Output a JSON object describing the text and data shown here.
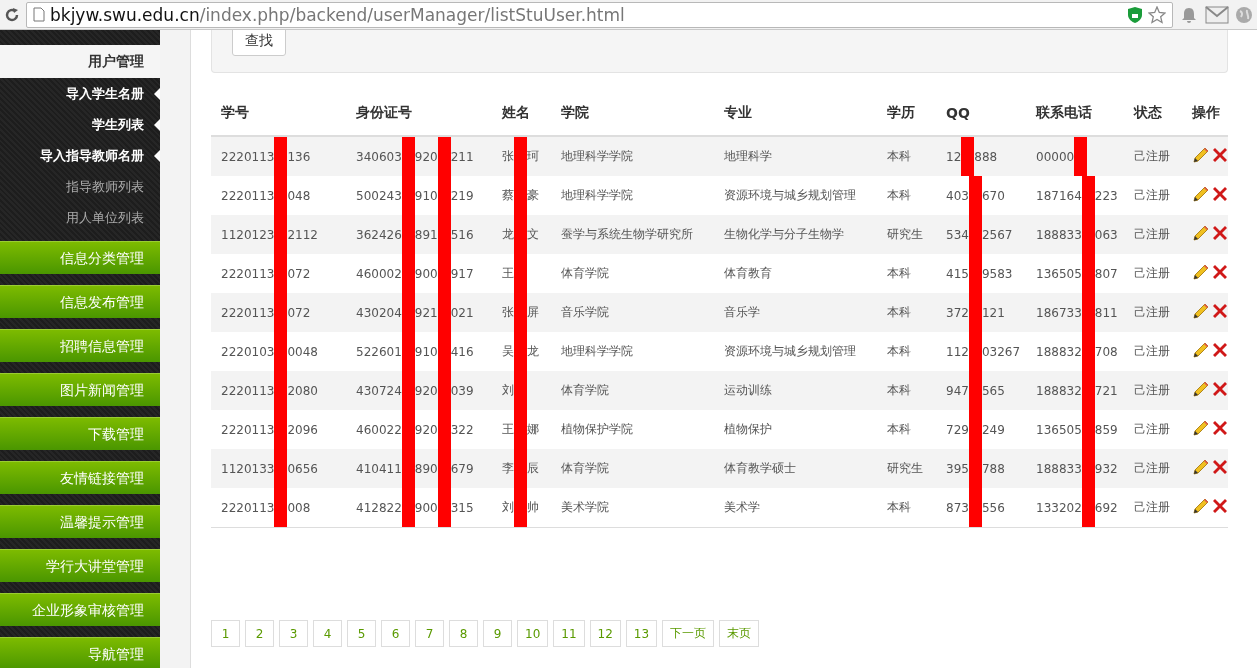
{
  "address_bar": {
    "domain": "bkjyw.swu.edu.cn",
    "path": "/index.php/backend/userManager/listStuUser.html"
  },
  "sidebar": {
    "section": "用户管理",
    "subitems": [
      {
        "label": "导入学生名册",
        "highlighted": true
      },
      {
        "label": "学生列表",
        "highlighted": true
      },
      {
        "label": "导入指导教师名册",
        "highlighted": true
      },
      {
        "label": "指导教师列表",
        "highlighted": false
      },
      {
        "label": "用人单位列表",
        "highlighted": false
      }
    ],
    "items": [
      "信息分类管理",
      "信息发布管理",
      "招聘信息管理",
      "图片新闻管理",
      "下载管理",
      "友情链接管理",
      "温馨提示管理",
      "学行大讲堂管理",
      "企业形象审核管理",
      "导航管理"
    ]
  },
  "search_button": "查找",
  "table": {
    "columns": [
      {
        "label": "学号",
        "kind": "text"
      },
      {
        "label": "身份证号",
        "kind": "text"
      },
      {
        "label": "姓名",
        "kind": "text"
      },
      {
        "label": "学院",
        "kind": "text"
      },
      {
        "label": "专业",
        "kind": "text"
      },
      {
        "label": "学历",
        "kind": "text"
      },
      {
        "label": "QQ",
        "kind": "text"
      },
      {
        "label": "联系电话",
        "kind": "text"
      },
      {
        "label": "状态",
        "kind": "text"
      },
      {
        "label": "操作",
        "kind": "actions"
      }
    ],
    "rows": [
      {
        "cells": [
          [
            "2220113",
            "136"
          ],
          [
            "340603",
            "920",
            "211"
          ],
          [
            "张",
            "珂"
          ],
          "地理科学学院",
          "地理科学",
          "本科",
          [
            "12",
            "888"
          ],
          [
            "00000"
          ],
          "己注册"
        ]
      },
      {
        "cells": [
          [
            "2220113",
            "048"
          ],
          [
            "500243",
            "910",
            "219"
          ],
          [
            "蔡",
            "豪"
          ],
          "地理科学学院",
          "资源环境与城乡规划管理",
          "本科",
          [
            "403",
            "670"
          ],
          [
            "187164",
            "223"
          ],
          "己注册"
        ]
      },
      {
        "cells": [
          [
            "1120123",
            "2112"
          ],
          [
            "362426",
            "891",
            "516"
          ],
          [
            "龙",
            "文"
          ],
          "蚕学与系统生物学研究所",
          "生物化学与分子生物学",
          "研究生",
          [
            "534",
            "2567"
          ],
          [
            "188833",
            "063"
          ],
          "己注册"
        ]
      },
      {
        "cells": [
          [
            "2220113",
            "072"
          ],
          [
            "460002",
            "900",
            "917"
          ],
          [
            "王"
          ],
          "体育学院",
          "体育教育",
          "本科",
          [
            "415",
            "9583"
          ],
          [
            "136505",
            "807"
          ],
          "己注册"
        ]
      },
      {
        "cells": [
          [
            "2220113",
            "072"
          ],
          [
            "430204",
            "921",
            "021"
          ],
          [
            "张",
            "屏"
          ],
          "音乐学院",
          "音乐学",
          "本科",
          [
            "372",
            "121"
          ],
          [
            "186733",
            "811"
          ],
          "己注册"
        ]
      },
      {
        "cells": [
          [
            "2220103",
            "0048"
          ],
          [
            "522601",
            "910",
            "416"
          ],
          [
            "吴",
            "龙"
          ],
          "地理科学学院",
          "资源环境与城乡规划管理",
          "本科",
          [
            "112",
            "03267"
          ],
          [
            "188832",
            "708"
          ],
          "己注册"
        ]
      },
      {
        "cells": [
          [
            "2220113",
            "2080"
          ],
          [
            "430724",
            "920",
            "039"
          ],
          [
            "刘"
          ],
          "体育学院",
          "运动训练",
          "本科",
          [
            "947",
            "565"
          ],
          [
            "188832",
            "721"
          ],
          "己注册"
        ]
      },
      {
        "cells": [
          [
            "2220113",
            "2096"
          ],
          [
            "460022",
            "920",
            "322"
          ],
          [
            "王",
            "娜"
          ],
          "植物保护学院",
          "植物保护",
          "本科",
          [
            "729",
            "249"
          ],
          [
            "136505",
            "859"
          ],
          "己注册"
        ]
      },
      {
        "cells": [
          [
            "1120133",
            "0656"
          ],
          [
            "410411",
            "890",
            "679"
          ],
          [
            "李",
            "辰"
          ],
          "体育学院",
          "体育教学硕士",
          "研究生",
          [
            "395",
            "788"
          ],
          [
            "188833",
            "932"
          ],
          "己注册"
        ]
      },
      {
        "cells": [
          [
            "2220113",
            "008"
          ],
          [
            "412822",
            "900",
            "315"
          ],
          [
            "刘",
            "帅"
          ],
          "美术学院",
          "美术学",
          "本科",
          [
            "873",
            "556"
          ],
          [
            "133202",
            "692"
          ],
          "己注册"
        ]
      }
    ]
  },
  "pagination": [
    "1",
    "2",
    "3",
    "4",
    "5",
    "6",
    "7",
    "8",
    "9",
    "10",
    "11",
    "12",
    "13",
    "下一页",
    "末页"
  ]
}
